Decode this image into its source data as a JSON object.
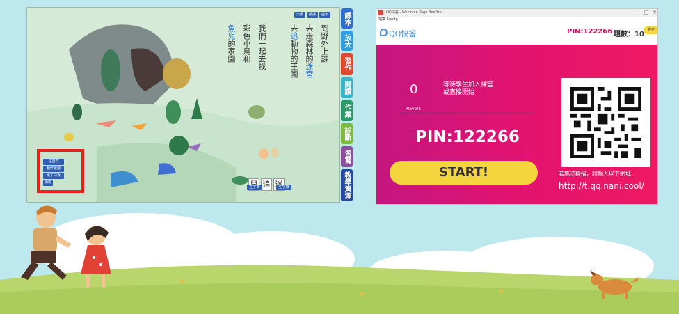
{
  "textbook": {
    "top_buttons": [
      "大綱",
      "朗讀",
      "提示"
    ],
    "poem_columns": [
      {
        "text": "到野外上課"
      },
      {
        "pre": "去走森林的",
        "hl": "迷宮",
        "post": ""
      },
      {
        "pre": "去",
        "hl": "追",
        "post": "動物的王國"
      },
      {
        "pre": "我們一起去找",
        "hl": "",
        "post": ""
      },
      {
        "pre": "彩色小鳥和",
        "hl": "",
        "post": ""
      },
      {
        "pre": "",
        "hl": "魚兒",
        "post": "的家園"
      }
    ],
    "side_tabs": [
      {
        "label": "課本",
        "color": "#2f6fd0"
      },
      {
        "label": "放大",
        "color": "#2f9de6"
      },
      {
        "label": "習作",
        "color": "#e1492f"
      },
      {
        "label": "閱讀",
        "color": "#38b6c9"
      },
      {
        "label": "作業",
        "color": "#2a9a6a"
      },
      {
        "label": "診斷",
        "color": "#7dbb3f"
      },
      {
        "label": "習寫",
        "color": "#8b4f9e"
      },
      {
        "label": "教學資源",
        "color": "#2348a8"
      }
    ],
    "menu_items": [
      "注音符",
      "動作遊戲",
      "電子白板",
      "測驗"
    ],
    "char_cards": [
      "兒",
      "追",
      "迷"
    ],
    "bottom_buttons": [
      "生字簿",
      "生字簿"
    ]
  },
  "qq": {
    "titlebar": "QQ快答 - Welcome Page BeeFire",
    "menubar": "檔案  Config",
    "logo": "QQ快答",
    "pin_top": "PIN:122266",
    "questions_label": "題數：10",
    "questions_badge": "設定",
    "players_count": "0",
    "players_label": "Players",
    "wait_text": "等待學生加入課堂或直接開始",
    "pin_big": "PIN:122266",
    "start_label": "START!",
    "alt_text": "若無法掃描，請輸入以下網址",
    "url": "http://t.qq.nani.cool/"
  },
  "colors": {
    "sky": "#bde9ee",
    "grass": "#b8d66b",
    "qq_pink": "#e21370",
    "start_yellow": "#f4d53d",
    "highlight_red": "#e8211f"
  }
}
